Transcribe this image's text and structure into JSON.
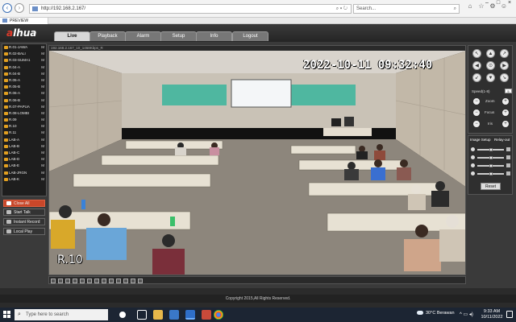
{
  "browser": {
    "url": "http://192.168.2.167/",
    "search_placeholder": "Search...",
    "tab_title": "PREVIEW"
  },
  "app": {
    "logo": "alhua",
    "nav_tabs": [
      "Live",
      "Playback",
      "Alarm",
      "Setup",
      "Info",
      "Logout"
    ],
    "active_tab": "Live"
  },
  "channels": [
    "R.01-JAWA",
    "R.02-BALI",
    "R.03-SUMA1",
    "R.04-A",
    "R.04-B",
    "R.05-A",
    "R.05-B",
    "R.06-A",
    "R.06-B",
    "R.07-PAPUA",
    "R.08-LOMBI",
    "R.09",
    "R.10",
    "R.11",
    "LAB-A",
    "LAB-B",
    "LAB-C",
    "LAB-D",
    "LAB-E",
    "LAB-JRGN",
    "LAB-K"
  ],
  "channel_mode_label": "M",
  "side_buttons": {
    "close_all": "Close All",
    "start_talk": "Start Talk",
    "instant_record": "Instant Record",
    "local_play": "Local Play"
  },
  "video": {
    "info_bar": "192.168.2.167_10_1468Kbps_R",
    "timestamp": "2022-10-11  09:32:40",
    "room_label": "R.10"
  },
  "ptz": {
    "speed_label": "Speed(1-8)",
    "speed_value": "5",
    "zoom_label": "Zoom",
    "focus_label": "Focus",
    "iris_label": "Iris"
  },
  "image_setup": {
    "tab_image": "Image Setup",
    "tab_relay": "Relay-out",
    "reset": "Reset",
    "slider_levels": [
      0.5,
      0.5,
      0.5,
      0.5
    ]
  },
  "footer": {
    "copyright": "Copyright 2015,All Rights Reserved."
  },
  "taskbar": {
    "search_placeholder": "Type here to search",
    "weather": "30°C  Berawan",
    "time": "9:33 AM",
    "date": "10/11/2022"
  }
}
